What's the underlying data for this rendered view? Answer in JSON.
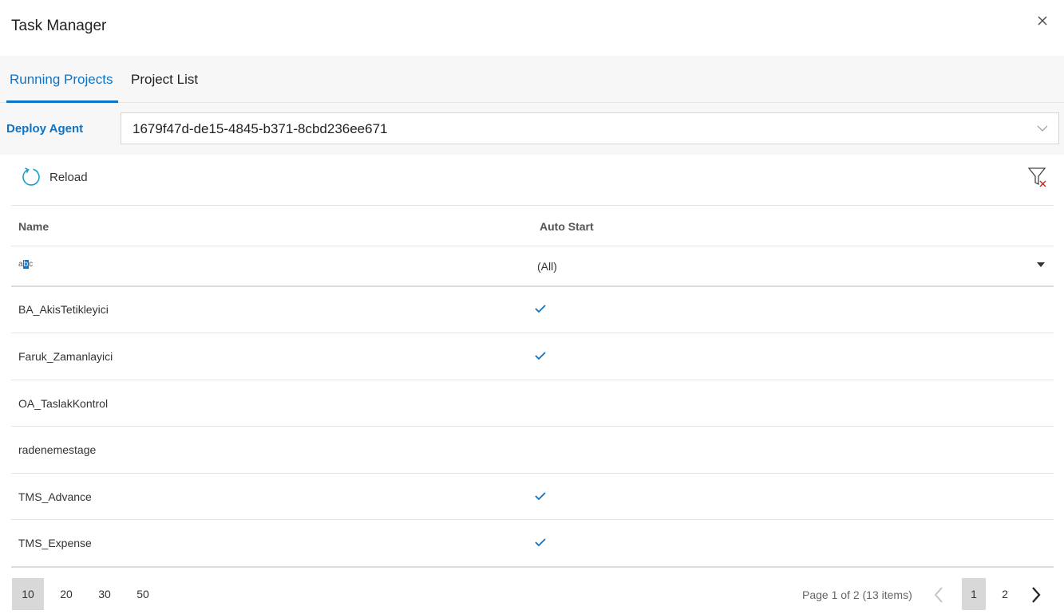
{
  "window": {
    "title": "Task Manager"
  },
  "tabs": [
    {
      "label": "Running Projects",
      "active": true
    },
    {
      "label": "Project List",
      "active": false
    }
  ],
  "deploy_agent": {
    "label": "Deploy Agent",
    "value": "1679f47d-de15-4845-b371-8cbd236ee671"
  },
  "toolbar": {
    "reload_label": "Reload"
  },
  "grid": {
    "columns": [
      "Name",
      "Auto Start"
    ],
    "filter": {
      "name_icon": "abc",
      "auto_start_value": "(All)"
    },
    "rows": [
      {
        "name": "BA_AkisTetikleyici",
        "auto_start": true
      },
      {
        "name": "Faruk_Zamanlayici",
        "auto_start": true
      },
      {
        "name": "OA_TaslakKontrol",
        "auto_start": false
      },
      {
        "name": "radenemestage",
        "auto_start": false
      },
      {
        "name": "TMS_Advance",
        "auto_start": true
      },
      {
        "name": "TMS_Expense",
        "auto_start": true
      }
    ]
  },
  "pager": {
    "page_sizes": [
      "10",
      "20",
      "30",
      "50"
    ],
    "selected_page_size": "10",
    "info": "Page 1 of 2 (13 items)",
    "pages": [
      "1",
      "2"
    ],
    "current_page": "1"
  },
  "colors": {
    "accent": "#0f73c4",
    "filter_clear": "#d9261c"
  }
}
